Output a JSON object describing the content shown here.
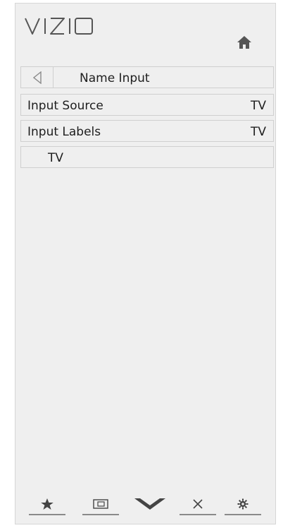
{
  "brand": {
    "logo_text": "VIZIO"
  },
  "header": {
    "home_icon": "home-icon"
  },
  "menu": {
    "title": "Name Input",
    "back_icon": "back-arrow-icon",
    "items": [
      {
        "label": "Input Source",
        "value": "TV"
      },
      {
        "label": "Input Labels",
        "value": "TV"
      },
      {
        "label": "TV",
        "value": ""
      }
    ]
  },
  "bottom_nav": [
    {
      "icon": "star-icon"
    },
    {
      "icon": "widescreen-icon"
    },
    {
      "icon": "v-logo-icon"
    },
    {
      "icon": "close-icon"
    },
    {
      "icon": "gear-icon"
    }
  ],
  "colors": {
    "panel": "#efefef",
    "border": "#cfcfcf",
    "text": "#1e1e1e",
    "icon": "#555555"
  }
}
